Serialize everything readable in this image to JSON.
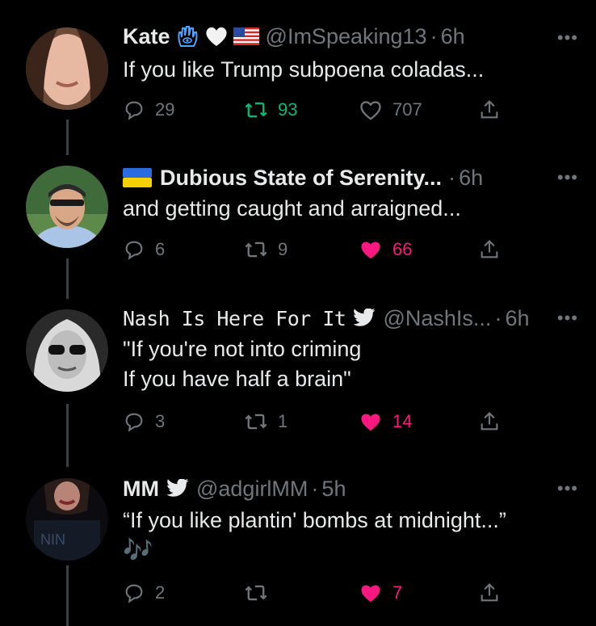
{
  "tweets": [
    {
      "name": "Kate",
      "handle": "@ImSpeaking13",
      "time": "6h",
      "badges": [
        "hamsa-icon",
        "white-heart-icon",
        "us-flag-icon"
      ],
      "text_lines": [
        "If you like Trump subpoena coladas..."
      ],
      "replies": "29",
      "retweets": "93",
      "likes": "707",
      "retweeted": true,
      "liked": false
    },
    {
      "name": "Dubious State of Serenity...",
      "handle": "",
      "time": "6h",
      "badges": [
        "ukraine-flag-icon"
      ],
      "text_lines": [
        "and getting caught and arraigned..."
      ],
      "replies": "6",
      "retweets": "9",
      "likes": "66",
      "retweeted": false,
      "liked": true
    },
    {
      "name": "Nash Is Here For It",
      "handle": "@NashIs...",
      "time": "6h",
      "badges": [
        "twitter-bird-icon"
      ],
      "text_lines": [
        "\"If you're not into criming",
        "If you have half a brain\""
      ],
      "replies": "3",
      "retweets": "1",
      "likes": "14",
      "retweeted": false,
      "liked": true
    },
    {
      "name": "MM",
      "handle": "@adgirlMM",
      "time": "5h",
      "badges": [
        "twitter-bird-icon"
      ],
      "text_lines": [
        "“If you like plantin' bombs at midnight...”"
      ],
      "emoji": "🎶",
      "replies": "2",
      "retweets": "",
      "likes": "7",
      "retweeted": false,
      "liked": true
    }
  ],
  "more_label": "•••",
  "dot": "·",
  "colors": {
    "background": "#000000",
    "text": "#e7e9ea",
    "muted": "#71767b",
    "retweet_active": "#00ba7c",
    "like_active": "#f91880"
  }
}
